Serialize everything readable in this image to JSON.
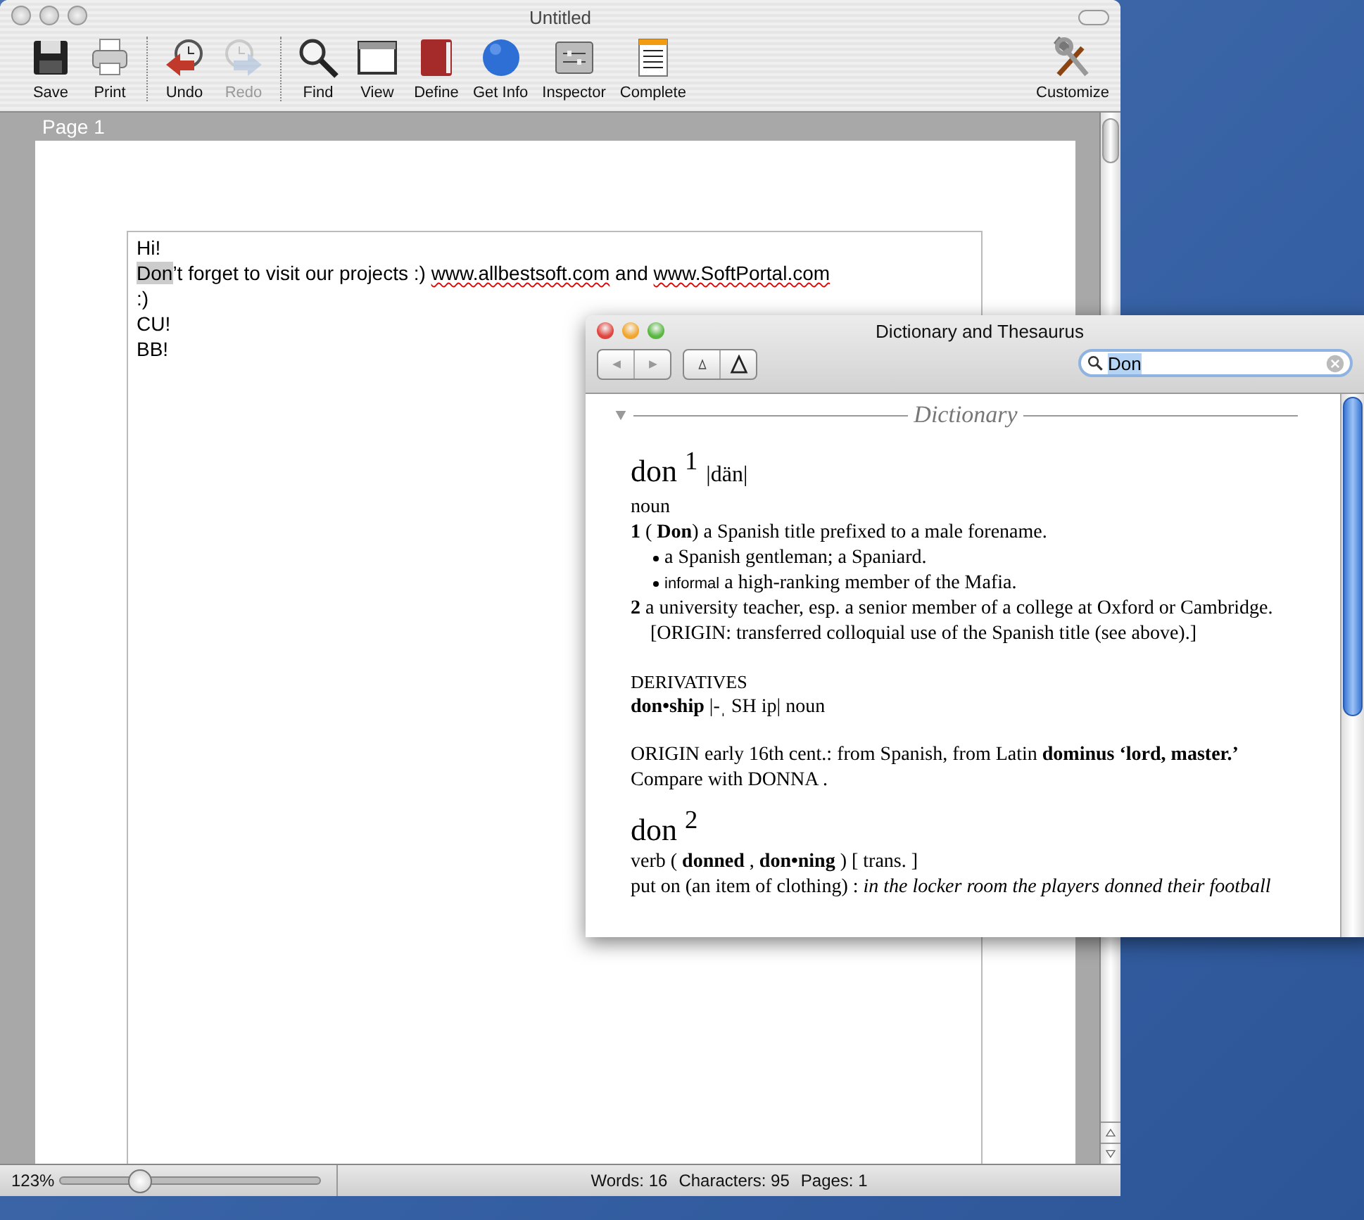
{
  "window": {
    "title": "Untitled"
  },
  "toolbar": {
    "groups": [
      [
        {
          "label": "Save",
          "disabled": false
        },
        {
          "label": "Print",
          "disabled": false
        }
      ],
      [
        {
          "label": "Undo",
          "disabled": false
        },
        {
          "label": "Redo",
          "disabled": true
        }
      ],
      [
        {
          "label": "Find",
          "disabled": false
        },
        {
          "label": "View",
          "disabled": false
        },
        {
          "label": "Define",
          "disabled": false
        },
        {
          "label": "Get Info",
          "disabled": false
        },
        {
          "label": "Inspector",
          "disabled": false
        },
        {
          "label": "Complete",
          "disabled": false
        }
      ]
    ],
    "customize": {
      "label": "Customize",
      "disabled": false
    }
  },
  "page": {
    "label": "Page 1",
    "lines": [
      [
        {
          "text": "Hi!",
          "kind": "plain"
        }
      ],
      [
        {
          "text": "Don",
          "kind": "selected"
        },
        {
          "text": "’t forget to visit our projects :) ",
          "kind": "plain"
        },
        {
          "text": "www.allbestsoft.com",
          "kind": "misspelled"
        },
        {
          "text": " and ",
          "kind": "plain"
        },
        {
          "text": "www.SoftPortal.com",
          "kind": "misspelled"
        }
      ],
      [
        {
          "text": ":)",
          "kind": "plain"
        }
      ],
      [
        {
          "text": "CU!",
          "kind": "plain"
        }
      ],
      [
        {
          "text": "BB!",
          "kind": "plain"
        }
      ]
    ]
  },
  "status_bar": {
    "zoom": "123%",
    "zoom_level": {
      "level": 0.31
    },
    "counts": [
      "Words: 16",
      "Characters: 95",
      "Pages: 1"
    ]
  },
  "dictionary_window": {
    "title": "Dictionary and Thesaurus",
    "search": {
      "value": "Don"
    },
    "section": "Dictionary",
    "expanded": true,
    "blocks": [
      {
        "kind": "headword",
        "text": "don $^{1}$",
        "pron": "|dän|"
      },
      {
        "kind": "line",
        "text": "noun"
      },
      {
        "kind": "sense",
        "text": "**1** ( **Don**) a Spanish title prefixed to a male forename."
      },
      {
        "kind": "bullet",
        "text": "a Spanish gentleman; a Spaniard."
      },
      {
        "kind": "bullet",
        "label": "informal",
        "text": "a high-ranking member of the Mafia."
      },
      {
        "kind": "sense",
        "text": "**2** a university teacher, esp. a senior member of a college at Oxford or Cambridge. [ORIGIN: transferred colloquial use of the Spanish title (see above).]"
      },
      {
        "kind": "heading",
        "text": "DERIVATIVES"
      },
      {
        "kind": "line",
        "text": "**don•ship** |-ˌ SH ip| noun"
      },
      {
        "kind": "para",
        "text": "ORIGIN early 16th cent.: from Spanish, from Latin **dominus ‘lord, master.’** Compare with DONNA ."
      },
      {
        "kind": "headword",
        "text": "don $^{2}$"
      },
      {
        "kind": "line",
        "text": "verb ( **donned** , **don•ning** ) [ trans. ]"
      },
      {
        "kind": "line",
        "text": "put on (an item of clothing) : *in the locker room the players donned their football*"
      }
    ]
  }
}
